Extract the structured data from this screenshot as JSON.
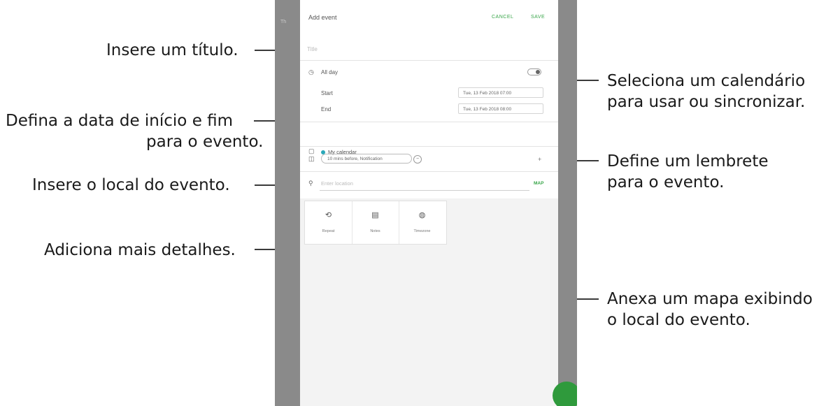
{
  "callouts": {
    "title": "Insere um título.",
    "dates_line1": "Defina a data de início e fim",
    "dates_line2": "para o evento.",
    "location": "Insere o local do evento.",
    "details": "Adiciona mais detalhes.",
    "calendar_line1": "Seleciona um calendário",
    "calendar_line2": "para usar ou sincronizar.",
    "reminder_line1": "Define um lembrete",
    "reminder_line2": "para o evento.",
    "map_line1": "Anexa um mapa exibindo",
    "map_line2": "o local do evento."
  },
  "screen": {
    "header_title": "Add event",
    "cancel_label": "CANCEL",
    "save_label": "SAVE",
    "title_placeholder": "Title",
    "all_day_label": "All day",
    "start_label": "Start",
    "end_label": "End",
    "start_value": "Tue, 13 Feb 2018   07:00",
    "end_value": "Tue, 13 Feb 2018   08:00",
    "calendar_label": "My calendar",
    "reminder_chip": "10 mins before, Notification",
    "location_placeholder": "Enter location",
    "map_label": "MAP",
    "detail_tiles": [
      "Repeat",
      "Notes",
      "Timezone"
    ]
  },
  "colors": {
    "accent": "#39a64a",
    "calendar_dot": "#2aa7b8",
    "backdrop": "#8f8f8f"
  }
}
